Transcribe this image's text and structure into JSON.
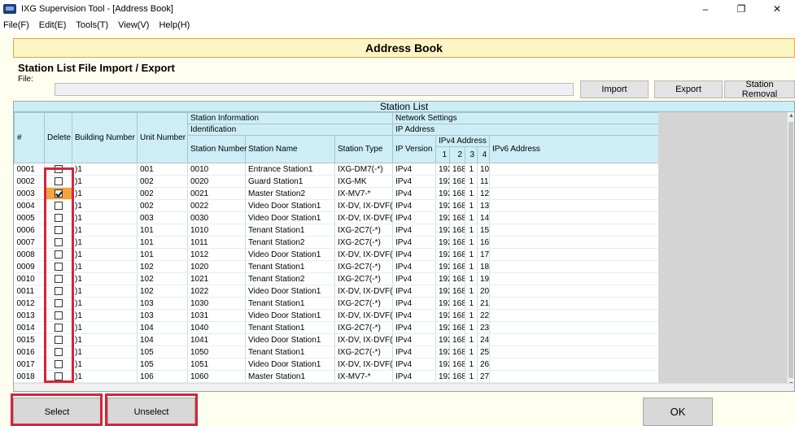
{
  "window": {
    "title": "IXG Supervision Tool - [Address Book]",
    "minimize": "–",
    "restore": "❐",
    "close": "✕"
  },
  "menu": [
    "File(F)",
    "Edit(E)",
    "Tools(T)",
    "View(V)",
    "Help(H)"
  ],
  "header": {
    "title": "Address Book"
  },
  "import_export": {
    "section_title": "Station List File Import / Export",
    "file_label": "File:",
    "file_value": "",
    "import_label": "Import",
    "export_label": "Export",
    "removal_label": "Station Removal"
  },
  "station_list": {
    "title": "Station List",
    "headers": {
      "num": "#",
      "delete": "Delete",
      "building": "Building Number",
      "unit": "Unit Number",
      "station_info": "Station Information",
      "identification": "Identification",
      "station_number": "Station Number",
      "station_name": "Station Name",
      "station_type": "Station Type",
      "network_settings": "Network Settings",
      "ip_address": "IP Address",
      "ip_version": "IP Version",
      "ipv4_address": "IPv4 Address",
      "oct1": "1",
      "oct2": "2",
      "oct3": "3",
      "oct4": "4",
      "ipv6": "IPv6 Address"
    },
    "rows": [
      {
        "num": "0001",
        "checked": false,
        "building": ")1",
        "unit": "001",
        "st_num": "0010",
        "name": "Entrance Station1",
        "type": "IXG-DM7(-*)",
        "ipver": "IPv4",
        "o1": "192",
        "o2": "168",
        "o3": "1",
        "o4": "10"
      },
      {
        "num": "0002",
        "checked": false,
        "building": ")1",
        "unit": "002",
        "st_num": "0020",
        "name": "Guard Station1",
        "type": "IXG-MK",
        "ipver": "IPv4",
        "o1": "192",
        "o2": "168",
        "o3": "1",
        "o4": "11"
      },
      {
        "num": "0003",
        "checked": true,
        "building": ")1",
        "unit": "002",
        "st_num": "0021",
        "name": "Master Station2",
        "type": "IX-MV7-*",
        "ipver": "IPv4",
        "o1": "192",
        "o2": "168",
        "o3": "1",
        "o4": "12"
      },
      {
        "num": "0004",
        "checked": false,
        "building": ")1",
        "unit": "002",
        "st_num": "0022",
        "name": "Video Door Station1",
        "type": "IX-DV, IX-DVF(-*)",
        "ipver": "IPv4",
        "o1": "192",
        "o2": "168",
        "o3": "1",
        "o4": "13"
      },
      {
        "num": "0005",
        "checked": false,
        "building": ")1",
        "unit": "003",
        "st_num": "0030",
        "name": "Video Door Station1",
        "type": "IX-DV, IX-DVF(-*)",
        "ipver": "IPv4",
        "o1": "192",
        "o2": "168",
        "o3": "1",
        "o4": "14"
      },
      {
        "num": "0006",
        "checked": false,
        "building": ")1",
        "unit": "101",
        "st_num": "1010",
        "name": "Tenant Station1",
        "type": "IXG-2C7(-*)",
        "ipver": "IPv4",
        "o1": "192",
        "o2": "168",
        "o3": "1",
        "o4": "15"
      },
      {
        "num": "0007",
        "checked": false,
        "building": ")1",
        "unit": "101",
        "st_num": "1011",
        "name": "Tenant Station2",
        "type": "IXG-2C7(-*)",
        "ipver": "IPv4",
        "o1": "192",
        "o2": "168",
        "o3": "1",
        "o4": "16"
      },
      {
        "num": "0008",
        "checked": false,
        "building": ")1",
        "unit": "101",
        "st_num": "1012",
        "name": "Video Door Station1",
        "type": "IX-DV, IX-DVF(-*)",
        "ipver": "IPv4",
        "o1": "192",
        "o2": "168",
        "o3": "1",
        "o4": "17"
      },
      {
        "num": "0009",
        "checked": false,
        "building": ")1",
        "unit": "102",
        "st_num": "1020",
        "name": "Tenant Station1",
        "type": "IXG-2C7(-*)",
        "ipver": "IPv4",
        "o1": "192",
        "o2": "168",
        "o3": "1",
        "o4": "18"
      },
      {
        "num": "0010",
        "checked": false,
        "building": ")1",
        "unit": "102",
        "st_num": "1021",
        "name": "Tenant Station2",
        "type": "IXG-2C7(-*)",
        "ipver": "IPv4",
        "o1": "192",
        "o2": "168",
        "o3": "1",
        "o4": "19"
      },
      {
        "num": "0011",
        "checked": false,
        "building": ")1",
        "unit": "102",
        "st_num": "1022",
        "name": "Video Door Station1",
        "type": "IX-DV, IX-DVF(-*)",
        "ipver": "IPv4",
        "o1": "192",
        "o2": "168",
        "o3": "1",
        "o4": "20"
      },
      {
        "num": "0012",
        "checked": false,
        "building": ")1",
        "unit": "103",
        "st_num": "1030",
        "name": "Tenant Station1",
        "type": "IXG-2C7(-*)",
        "ipver": "IPv4",
        "o1": "192",
        "o2": "168",
        "o3": "1",
        "o4": "21"
      },
      {
        "num": "0013",
        "checked": false,
        "building": ")1",
        "unit": "103",
        "st_num": "1031",
        "name": "Video Door Station1",
        "type": "IX-DV, IX-DVF(-*)",
        "ipver": "IPv4",
        "o1": "192",
        "o2": "168",
        "o3": "1",
        "o4": "22"
      },
      {
        "num": "0014",
        "checked": false,
        "building": ")1",
        "unit": "104",
        "st_num": "1040",
        "name": "Tenant Station1",
        "type": "IXG-2C7(-*)",
        "ipver": "IPv4",
        "o1": "192",
        "o2": "168",
        "o3": "1",
        "o4": "23"
      },
      {
        "num": "0015",
        "checked": false,
        "building": ")1",
        "unit": "104",
        "st_num": "1041",
        "name": "Video Door Station1",
        "type": "IX-DV, IX-DVF(-*)",
        "ipver": "IPv4",
        "o1": "192",
        "o2": "168",
        "o3": "1",
        "o4": "24"
      },
      {
        "num": "0016",
        "checked": false,
        "building": ")1",
        "unit": "105",
        "st_num": "1050",
        "name": "Tenant Station1",
        "type": "IXG-2C7(-*)",
        "ipver": "IPv4",
        "o1": "192",
        "o2": "168",
        "o3": "1",
        "o4": "25"
      },
      {
        "num": "0017",
        "checked": false,
        "building": ")1",
        "unit": "105",
        "st_num": "1051",
        "name": "Video Door Station1",
        "type": "IX-DV, IX-DVF(-*)",
        "ipver": "IPv4",
        "o1": "192",
        "o2": "168",
        "o3": "1",
        "o4": "26"
      },
      {
        "num": "0018",
        "checked": false,
        "building": ")1",
        "unit": "106",
        "st_num": "1060",
        "name": "Master Station1",
        "type": "IX-MV7-*",
        "ipver": "IPv4",
        "o1": "192",
        "o2": "168",
        "o3": "1",
        "o4": "27"
      }
    ]
  },
  "footer": {
    "select_label": "Select",
    "unselect_label": "Unselect",
    "ok_label": "OK"
  },
  "colors": {
    "highlight_red": "#d4253b",
    "checked_cell": "#f3a53b",
    "header_blue": "#cdeef6",
    "band_border": "#e9a052"
  }
}
